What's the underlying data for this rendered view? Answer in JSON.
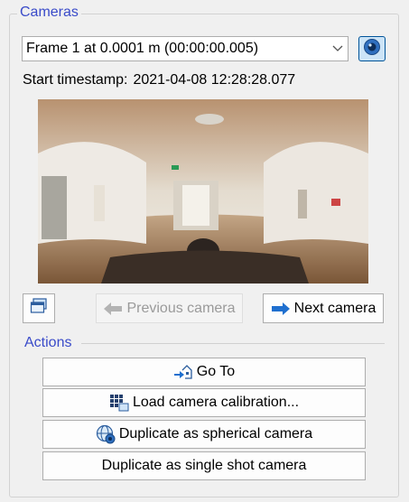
{
  "group_title": "Cameras",
  "frame_select": {
    "value": "Frame 1 at 0.0001 m (00:00:00.005)"
  },
  "start_timestamp": {
    "label": "Start timestamp:",
    "value": "2021-04-08 12:28:28.077"
  },
  "nav": {
    "previous_label": "Previous camera",
    "next_label": "Next camera"
  },
  "actions": {
    "title": "Actions",
    "go_to": "Go To",
    "load_calibration": "Load camera calibration...",
    "duplicate_spherical": "Duplicate as spherical camera",
    "duplicate_single": "Duplicate as single shot camera"
  },
  "colors": {
    "accent_title": "#3a4bc9",
    "eye_button_bg": "#cce4f7",
    "arrow_blue": "#1f6fcf"
  }
}
